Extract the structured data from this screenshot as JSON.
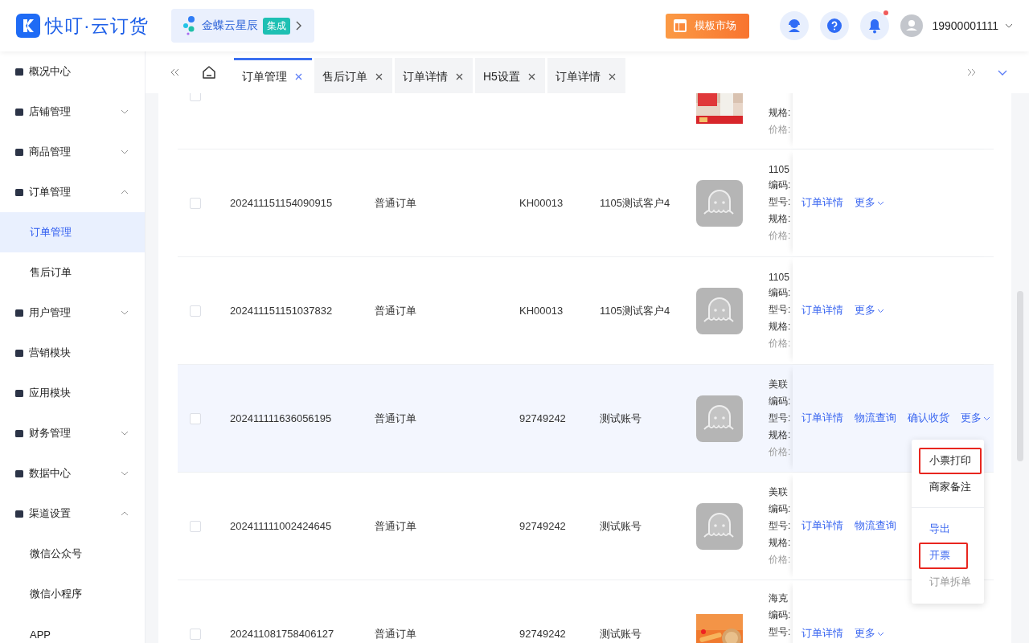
{
  "header": {
    "logo_text": "快叮·云订货",
    "integration": {
      "name": "金蝶云星辰",
      "tag": "集成"
    },
    "market_button": "模板市场",
    "notification_dot": true,
    "user": "19900001111"
  },
  "sidebar": {
    "items": [
      {
        "label": "概况中心"
      },
      {
        "label": "店铺管理",
        "expanded": false
      },
      {
        "label": "商品管理",
        "expanded": false
      },
      {
        "label": "订单管理",
        "expanded": true,
        "children": [
          {
            "label": "订单管理",
            "selected": true
          },
          {
            "label": "售后订单",
            "selected": false
          }
        ]
      },
      {
        "label": "用户管理",
        "expanded": false
      },
      {
        "label": "营销模块"
      },
      {
        "label": "应用模块"
      },
      {
        "label": "财务管理",
        "expanded": false
      },
      {
        "label": "数据中心",
        "expanded": false
      },
      {
        "label": "渠道设置",
        "expanded": true,
        "children": [
          {
            "label": "微信公众号",
            "selected": false
          },
          {
            "label": "微信小程序",
            "selected": false
          },
          {
            "label": "APP",
            "selected": false
          }
        ]
      }
    ]
  },
  "tabs": [
    {
      "label": "订单管理",
      "selected": true
    },
    {
      "label": "售后订单",
      "selected": false
    },
    {
      "label": "订单详情",
      "selected": false
    },
    {
      "label": "H5设置",
      "selected": false
    },
    {
      "label": "订单详情",
      "selected": false
    }
  ],
  "rows": [
    {
      "hovered": false,
      "kind": "picture",
      "info": [
        "规格:",
        "价格:"
      ],
      "actions": []
    },
    {
      "hovered": false,
      "order_no": "202411151154090915",
      "type": "普通订单",
      "code": "KH00013",
      "customer": "1105测试客户4",
      "kind": "placeholder",
      "info": [
        "1105",
        "编码:",
        "型号:",
        "规格:",
        "价格:"
      ],
      "actions": [
        "订单详情",
        "更多"
      ]
    },
    {
      "hovered": false,
      "order_no": "202411151151037832",
      "type": "普通订单",
      "code": "KH00013",
      "customer": "1105测试客户4",
      "kind": "placeholder",
      "info": [
        "1105",
        "编码:",
        "型号:",
        "规格:",
        "价格:"
      ],
      "actions": [
        "订单详情",
        "更多"
      ]
    },
    {
      "hovered": true,
      "order_no": "202411111636056195",
      "type": "普通订单",
      "code": "92749242",
      "customer": "测试账号",
      "kind": "placeholder",
      "info": [
        "美联",
        "编码:",
        "型号:",
        "规格:",
        "价格:"
      ],
      "actions": [
        "订单详情",
        "物流查询",
        "确认收货",
        "更多"
      ]
    },
    {
      "hovered": false,
      "order_no": "202411111002424645",
      "type": "普通订单",
      "code": "92749242",
      "customer": "测试账号",
      "kind": "placeholder",
      "info": [
        "美联",
        "编码:",
        "型号:",
        "规格:",
        "价格:"
      ],
      "actions": [
        "订单详情",
        "物流查询"
      ]
    },
    {
      "hovered": false,
      "order_no": "202411081758406127",
      "type": "普通订单",
      "code": "92749242",
      "customer": "测试账号",
      "kind": "picture",
      "info": [
        "海克",
        "编码:",
        "型号:"
      ],
      "actions": [
        "订单详情",
        "更多"
      ]
    }
  ],
  "dropdown": {
    "items": [
      {
        "label": "小票打印",
        "kind": "normal",
        "highlighted": true
      },
      {
        "label": "商家备注",
        "kind": "normal",
        "highlighted": false
      },
      {
        "label": "导出",
        "kind": "link",
        "highlighted": false
      },
      {
        "label": "开票",
        "kind": "link",
        "highlighted": true
      },
      {
        "label": "订单拆单",
        "kind": "disabled",
        "highlighted": false
      }
    ]
  }
}
